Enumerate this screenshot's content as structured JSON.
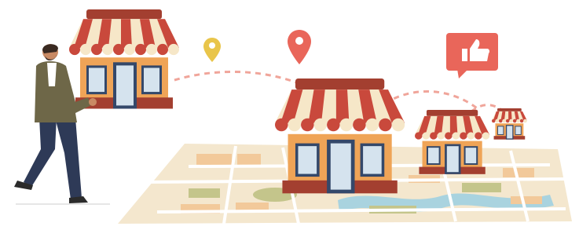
{
  "illustration": {
    "subject": "store-franchise-expansion",
    "icons": {
      "pin_small": "location-pin-icon",
      "pin_large": "location-pin-icon",
      "like_bubble": "thumbs-up-icon"
    },
    "colors": {
      "awning_red": "#C9493C",
      "awning_cream": "#F6E7C8",
      "wall_orange": "#EFA457",
      "roof_brown": "#A33F30",
      "door_blue": "#34486A",
      "pin_yellow": "#E9C54A",
      "pin_red": "#E9665A",
      "map_base": "#F4E7CE",
      "map_road": "#FFFFFF",
      "map_water": "#A9D3DF",
      "map_green": "#C4C58B",
      "map_block": "#F2C99A",
      "jacket": "#6E6748",
      "trousers": "#2E3A57",
      "dashed_path": "#F0A59A"
    }
  }
}
